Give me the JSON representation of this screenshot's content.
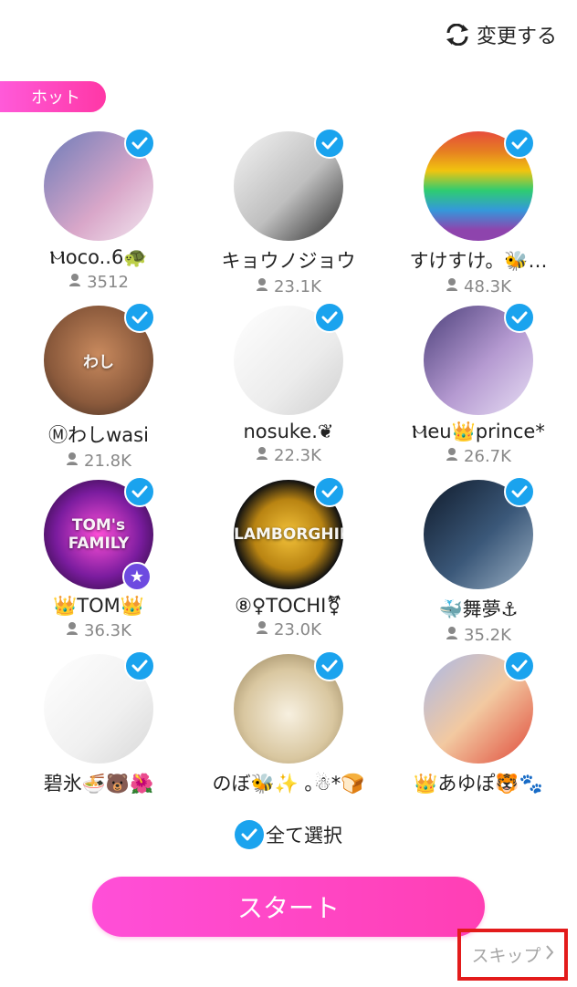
{
  "header": {
    "change_label": "変更する",
    "hot_tab_label": "ホット"
  },
  "users": [
    {
      "name": "Ⲙoco..6🐢",
      "followers": "3512",
      "avatar_bg": "linear-gradient(135deg,#6c7bb8,#d9a7c9 60%,#f2e7f0)",
      "hint": ""
    },
    {
      "name": "キョウノジョウ",
      "followers": "23.1K",
      "avatar_bg": "linear-gradient(135deg,#f4f4f4,#bfbfbf 55%,#2b2b2b)",
      "hint": ""
    },
    {
      "name": "すけすけ。🐝…",
      "followers": "48.3K",
      "avatar_bg": "linear-gradient(180deg,#e74c3c 0%,#e67e22 18%,#f1c40f 36%,#2ecc71 54%,#3498db 72%,#8e44ad 90%)",
      "hint": ""
    },
    {
      "name": "Ⓜわしwasi",
      "followers": "21.8K",
      "avatar_bg": "radial-gradient(circle at 50% 45%,#c98a5e,#8b5a3c 60%,#3a2a20)",
      "hint": "わし"
    },
    {
      "name": "nosuke.❦",
      "followers": "22.3K",
      "avatar_bg": "linear-gradient(135deg,#ffffff,#ececec 60%,#cfcfcf)",
      "hint": ""
    },
    {
      "name": "Ⲙeu👑prince*",
      "followers": "26.7K",
      "avatar_bg": "linear-gradient(135deg,#4b3f7a,#b59ad1 55%,#e8dff5)",
      "hint": ""
    },
    {
      "name": "👑TOM👑",
      "followers": "36.3K",
      "avatar_bg": "radial-gradient(circle at 50% 50%,#ff4fd8,#7a1c9e 55%,#14061f)",
      "hint": "TOM's FAMILY"
    },
    {
      "name": "⑧♀TOCHI⚧",
      "followers": "23.0K",
      "avatar_bg": "radial-gradient(circle at 50% 50%,#f3c23a,#b98412 45%,#111 70%)",
      "hint": "LAMBORGHINI"
    },
    {
      "name": "🐳舞夢⚓",
      "followers": "35.2K",
      "avatar_bg": "linear-gradient(135deg,#0f1a2a,#3b5879 55%,#9bb0c4)",
      "hint": ""
    },
    {
      "name": "碧氷🍜🐻🌺",
      "followers": "",
      "avatar_bg": "linear-gradient(135deg,#ffffff,#f0f0f0 60%,#d8d8d8)",
      "hint": ""
    },
    {
      "name": "のぼ🐝✨ ｡☃*🍞",
      "followers": "",
      "avatar_bg": "radial-gradient(circle at 50% 55%,#f7f0e0,#d9c7a0 55%,#8a7650)",
      "hint": ""
    },
    {
      "name": "👑あゆぽ🐯🐾",
      "followers": "",
      "avatar_bg": "linear-gradient(135deg,#a9b8e8,#f2c9a1 50%,#e04a3a)",
      "hint": ""
    }
  ],
  "footer": {
    "select_all_label": "全て選択",
    "start_label": "スタート",
    "skip_label": "スキップ"
  },
  "colors": {
    "accent_pink": "#ff3fb4",
    "check_blue": "#1aa3ee",
    "skip_highlight": "#e31b1b"
  }
}
